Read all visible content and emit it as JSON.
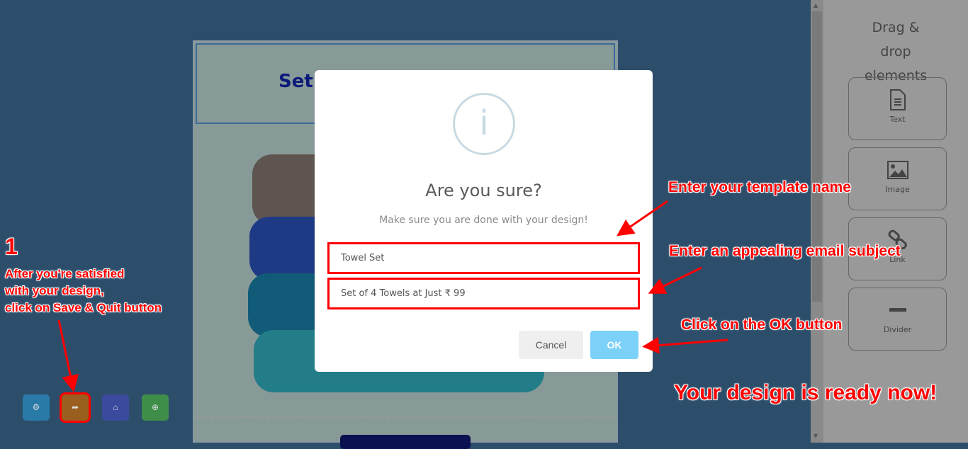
{
  "canvas": {
    "header_title": "Set"
  },
  "toolbar": [
    {
      "name": "settings",
      "icon": "gear-icon",
      "glyph": "⚙",
      "color": "#2a7aa8"
    },
    {
      "name": "save-quit",
      "icon": "exit-icon",
      "glyph": "➦",
      "color": "#9a5f1f"
    },
    {
      "name": "save",
      "icon": "inbox-icon",
      "glyph": "⌂",
      "color": "#3c4a9e"
    },
    {
      "name": "zoom",
      "icon": "zoom-in-icon",
      "glyph": "⊕",
      "color": "#3e8e4a"
    }
  ],
  "panel": {
    "title": "Drag & drop elements",
    "elements": [
      {
        "label": "Text",
        "icon": "file-text-icon"
      },
      {
        "label": "Image",
        "icon": "image-icon"
      },
      {
        "label": "Link",
        "icon": "link-icon"
      },
      {
        "label": "Divider",
        "icon": "divider-icon"
      }
    ]
  },
  "modal": {
    "icon": "info-icon",
    "icon_glyph": "i",
    "title": "Are you sure?",
    "subtitle": "Make sure you are done with your design!",
    "template_name": "Towel Set",
    "email_subject": "Set of 4 Towels at Just ₹ 99",
    "cancel": "Cancel",
    "ok": "OK"
  },
  "annotations": {
    "step": "1",
    "step_text_1": "After you're satisfied",
    "step_text_2": "with your design,",
    "step_text_3": "click on Save & Quit button",
    "template": "Enter your template name",
    "subject": "Enter an appealing email subject",
    "ok": "Click on the OK button",
    "ready": "Your design is ready now!"
  },
  "colors": {
    "annotation": "#ff0000",
    "ok_button": "#7cd1f9"
  }
}
